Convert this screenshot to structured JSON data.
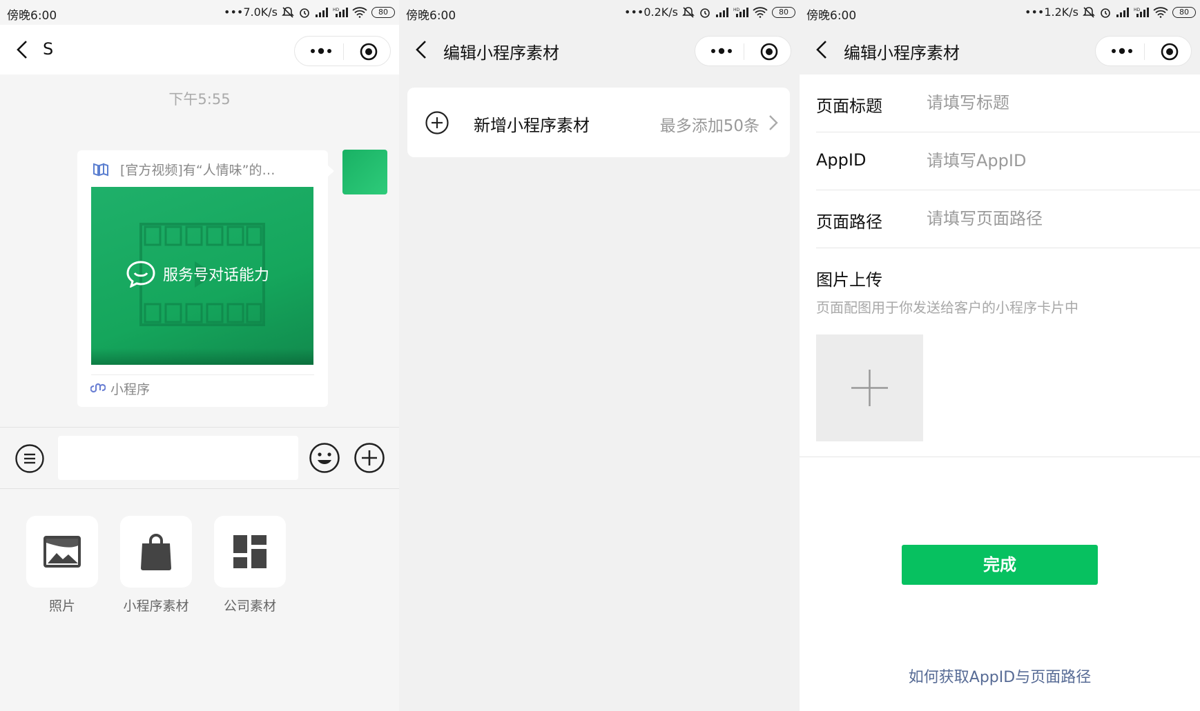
{
  "panel1": {
    "status": {
      "time": "傍晚6:00",
      "speed": "7.0K/s",
      "battery": "80"
    },
    "nav": {
      "title": "S"
    },
    "chat_time": "下午5:55",
    "card": {
      "title": "[官方视频]有“人情味”的…",
      "cover_text": "服务号对话能力",
      "footer": "小程序"
    },
    "tools": [
      {
        "label": "照片",
        "icon": "image-icon"
      },
      {
        "label": "小程序素材",
        "icon": "shopping-bag-icon"
      },
      {
        "label": "公司素材",
        "icon": "dashboard-icon"
      }
    ]
  },
  "panel2": {
    "status": {
      "time": "傍晚6:00",
      "speed": "0.2K/s",
      "battery": "80"
    },
    "nav": {
      "title": "编辑小程序素材"
    },
    "add_item": {
      "label": "新增小程序素材",
      "hint": "最多添加50条"
    }
  },
  "panel3": {
    "status": {
      "time": "傍晚6:00",
      "speed": "1.2K/s",
      "battery": "80"
    },
    "nav": {
      "title": "编辑小程序素材"
    },
    "fields": [
      {
        "label": "页面标题",
        "placeholder": "请填写标题"
      },
      {
        "label": "AppID",
        "placeholder": "请填写AppID"
      },
      {
        "label": "页面路径",
        "placeholder": "请填写页面路径"
      }
    ],
    "image_upload": {
      "title": "图片上传",
      "hint": "页面配图用于你发送给客户的小程序卡片中"
    },
    "done_label": "完成",
    "help_link": "如何获取AppID与页面路径"
  },
  "colors": {
    "primary_green": "#07c160",
    "link_blue": "#576b95",
    "cover_green": "#1aad62"
  }
}
